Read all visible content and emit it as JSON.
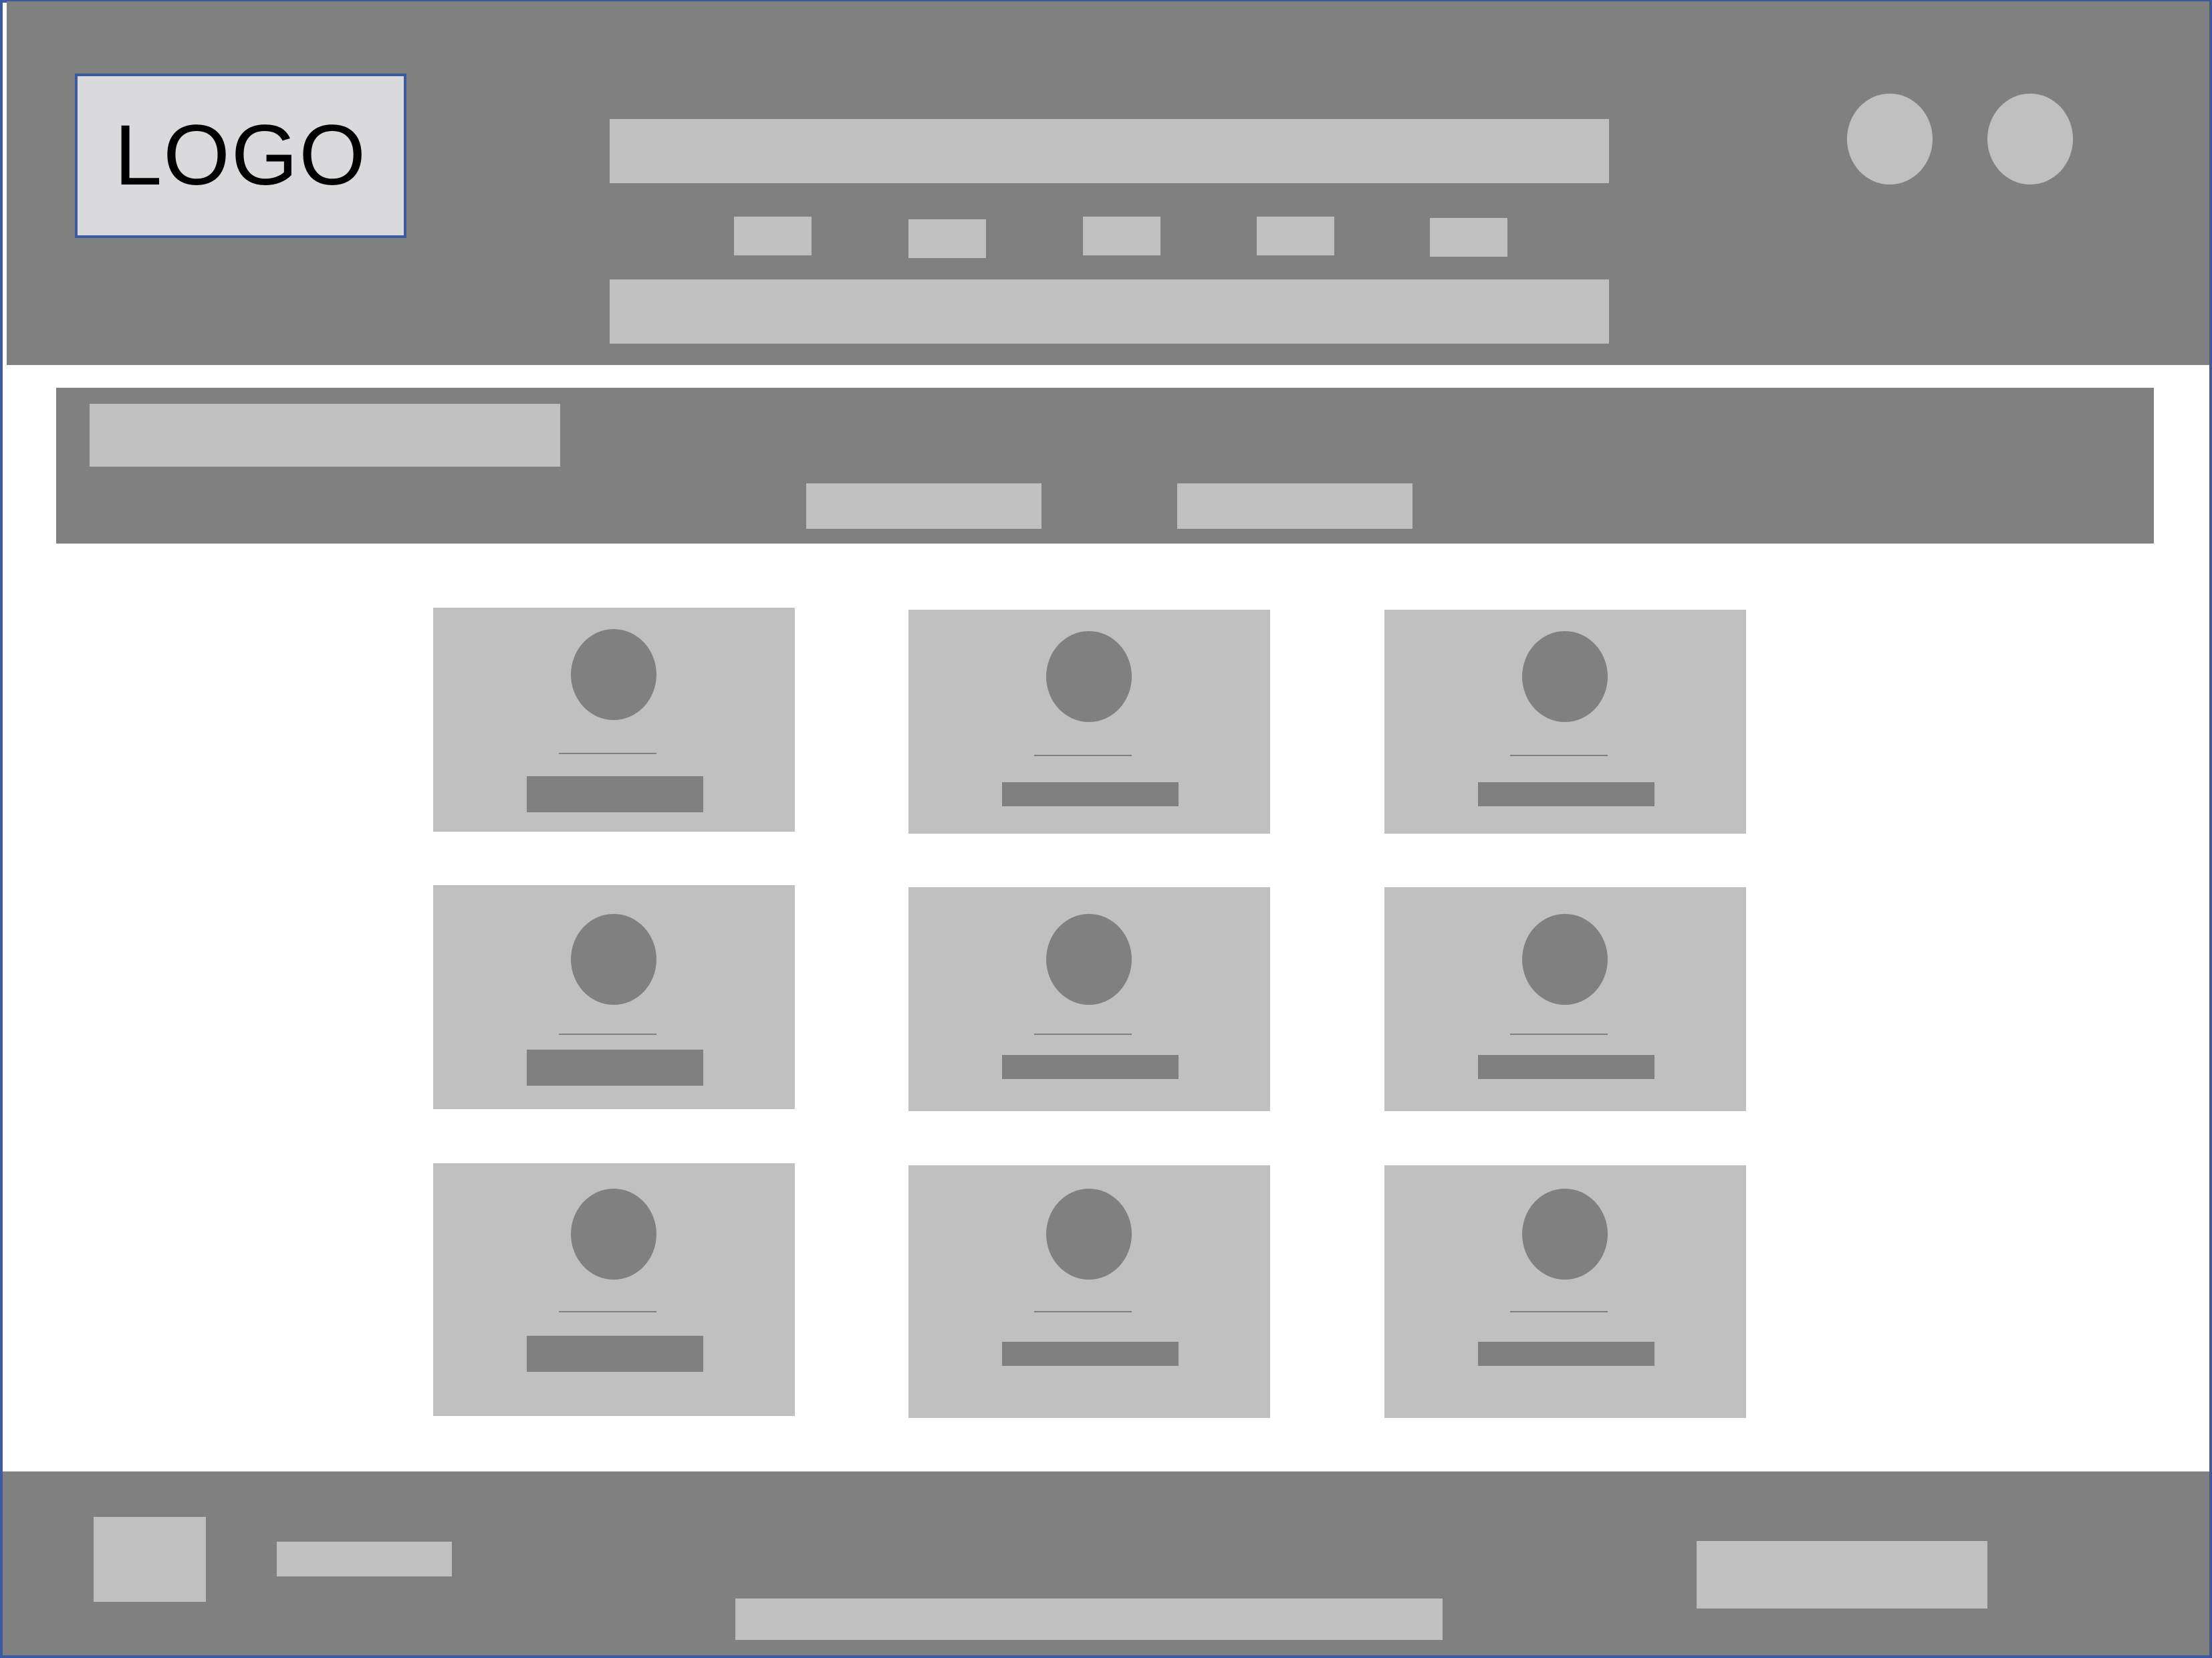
{
  "header": {
    "logo_text": "LOGO"
  },
  "colors": {
    "panel": "#808080",
    "placeholder": "#c0c0c0",
    "logo_box": "#dadadc",
    "frame_border": "#3b5aa0",
    "background": "#ffffff"
  },
  "icons": {
    "header_circles": [
      "avatar-icon",
      "avatar-icon"
    ],
    "card_avatar": "avatar-icon"
  },
  "grid": {
    "rows": 3,
    "columns": 3,
    "card_count": 9
  }
}
